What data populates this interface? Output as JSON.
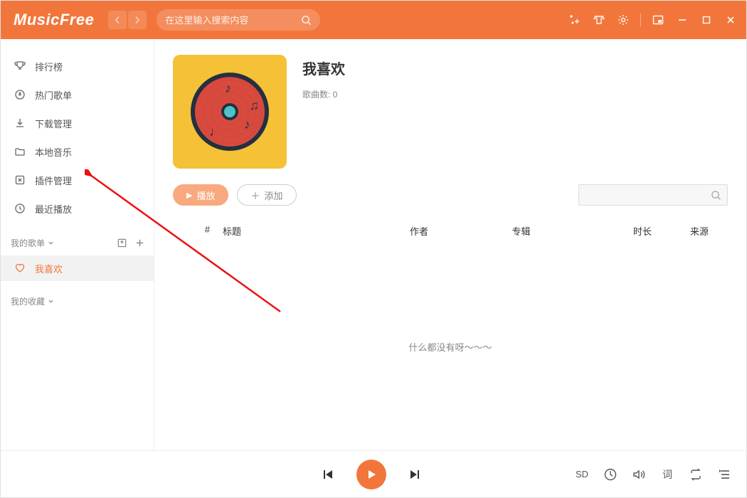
{
  "app": {
    "name": "MusicFree"
  },
  "search": {
    "placeholder": "在这里输入搜索内容"
  },
  "sidebar": {
    "items": [
      {
        "label": "排行榜"
      },
      {
        "label": "热门歌单"
      },
      {
        "label": "下载管理"
      },
      {
        "label": "本地音乐"
      },
      {
        "label": "插件管理"
      },
      {
        "label": "最近播放"
      }
    ],
    "my_playlists_label": "我的歌单",
    "favorites_label": "我喜欢",
    "my_collections_label": "我的收藏"
  },
  "main": {
    "title": "我喜欢",
    "song_count_label": "歌曲数: 0",
    "play_btn": "播放",
    "add_btn": "添加",
    "filter_placeholder": "",
    "columns": {
      "index": "#",
      "title": "标题",
      "artist": "作者",
      "album": "专辑",
      "duration": "时长",
      "source": "来源"
    },
    "empty_text": "什么都没有呀～～～"
  },
  "player": {
    "quality": "SD",
    "lyric_label": "词"
  }
}
